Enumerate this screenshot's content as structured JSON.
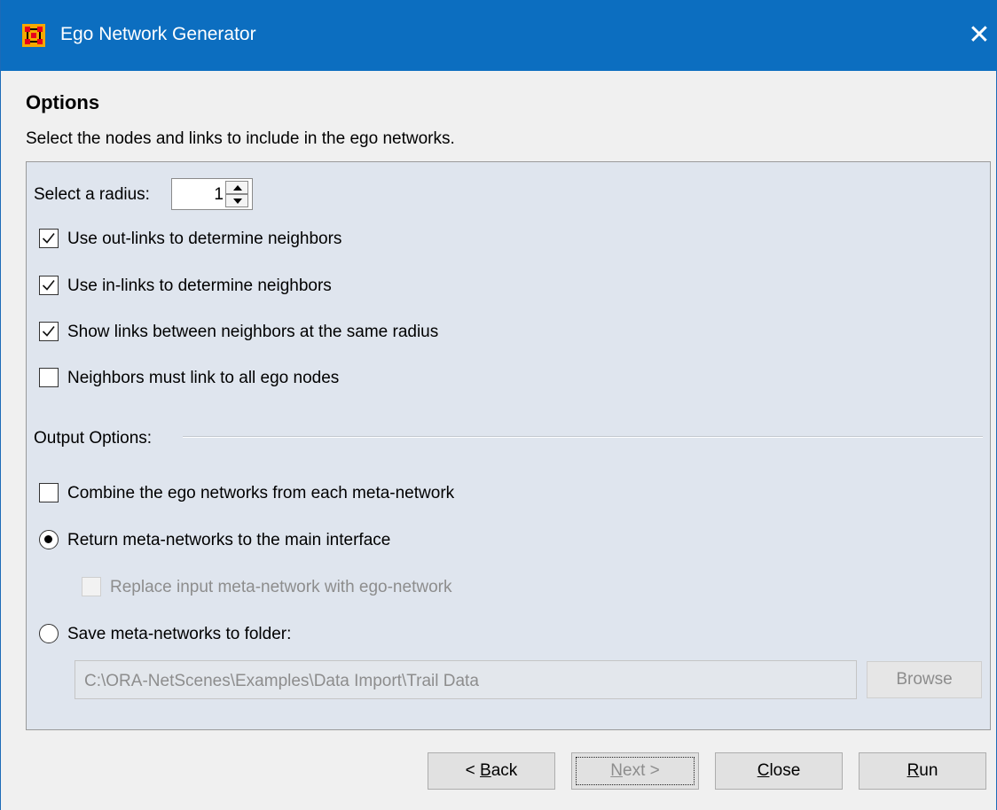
{
  "window": {
    "title": "Ego Network Generator",
    "close_label": "✕",
    "accent": "#0c6ec0",
    "app_icon": "ora-grid-icon"
  },
  "content": {
    "heading": "Options",
    "subtitle": "Select the nodes and links to include in the ego networks."
  },
  "radius": {
    "label": "Select a radius:",
    "value": "1"
  },
  "neighbor_options": [
    {
      "label": "Use out-links to determine neighbors",
      "checked": true
    },
    {
      "label": "Use in-links to determine neighbors",
      "checked": true
    },
    {
      "label": "Show links between neighbors at the same radius",
      "checked": true
    },
    {
      "label": "Neighbors must link to all ego nodes",
      "checked": false
    }
  ],
  "output": {
    "section_label": "Output Options:",
    "combine": {
      "label": "Combine the ego networks from each meta-network",
      "checked": false
    },
    "return_radio": {
      "label": "Return meta-networks to the main interface",
      "selected": true
    },
    "replace": {
      "label": "Replace input meta-network with ego-network",
      "checked": false,
      "enabled": false
    },
    "save_radio": {
      "label": "Save meta-networks to folder:",
      "selected": false
    },
    "folder_path": "C:\\ORA-NetScenes\\Examples\\Data Import\\Trail Data",
    "browse_label": "Browse"
  },
  "buttons": {
    "back": {
      "prefix": "< ",
      "mnemonic": "B",
      "rest": "ack"
    },
    "next": {
      "mnemonic": "N",
      "rest": "ext >"
    },
    "close": {
      "mnemonic": "C",
      "rest": "lose"
    },
    "run": {
      "mnemonic": "R",
      "rest": "un"
    }
  }
}
